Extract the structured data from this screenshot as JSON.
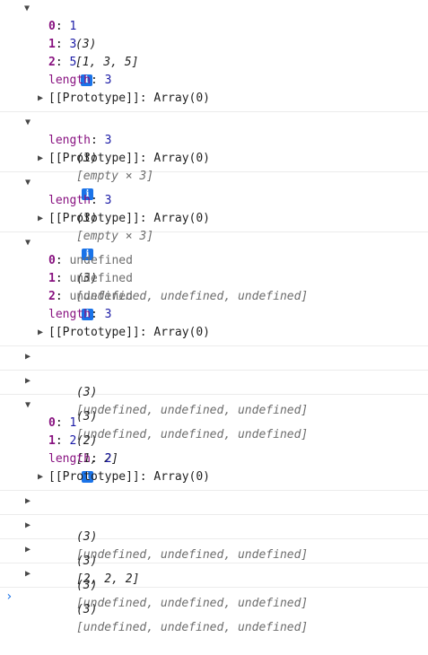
{
  "console": {
    "entries": [
      {
        "count": "(3)",
        "preview": "[1, 3, 5]",
        "props": [
          {
            "key": "0",
            "value": "1"
          },
          {
            "key": "1",
            "value": "3"
          },
          {
            "key": "2",
            "value": "5"
          }
        ],
        "length_key": "length",
        "length_value": "3",
        "proto": "[[Prototype]]: Array(0)"
      },
      {
        "count": "(3)",
        "preview": "[empty × 3]",
        "length_key": "length",
        "length_value": "3",
        "proto": "[[Prototype]]: Array(0)"
      },
      {
        "count": "(3)",
        "preview": "[empty × 3]",
        "length_key": "length",
        "length_value": "3",
        "proto": "[[Prototype]]: Array(0)"
      },
      {
        "count": "(3)",
        "preview": "[undefined, undefined, undefined]",
        "props": [
          {
            "key": "0",
            "value": "undefined"
          },
          {
            "key": "1",
            "value": "undefined"
          },
          {
            "key": "2",
            "value": "undefined"
          }
        ],
        "length_key": "length",
        "length_value": "3",
        "proto": "[[Prototype]]: Array(0)"
      },
      {
        "count": "(3)",
        "preview": "[undefined, undefined, undefined]"
      },
      {
        "count": "(3)",
        "preview": "[undefined, undefined, undefined]"
      },
      {
        "count": "(2)",
        "preview": "[1, 2]",
        "props": [
          {
            "key": "0",
            "value": "1"
          },
          {
            "key": "1",
            "value": "2"
          }
        ],
        "length_key": "length",
        "length_value": "2",
        "proto": "[[Prototype]]: Array(0)"
      },
      {
        "count": "(3)",
        "preview": "[undefined, undefined, undefined]"
      },
      {
        "count": "(3)",
        "preview": "[2, 2, 2]"
      },
      {
        "count": "(3)",
        "preview": "[undefined, undefined, undefined]"
      },
      {
        "count": "(3)",
        "preview": "[undefined, undefined, undefined]"
      }
    ],
    "expanded_glyph": "▼",
    "collapsed_glyph": "▶",
    "info_glyph": "i",
    "prompt_glyph": "›"
  },
  "colors": {
    "key": "#881280",
    "number": "#1a1aa6",
    "undefined": "#6d6d6d",
    "info_badge": "#1a73e8",
    "divider": "#ececec"
  }
}
